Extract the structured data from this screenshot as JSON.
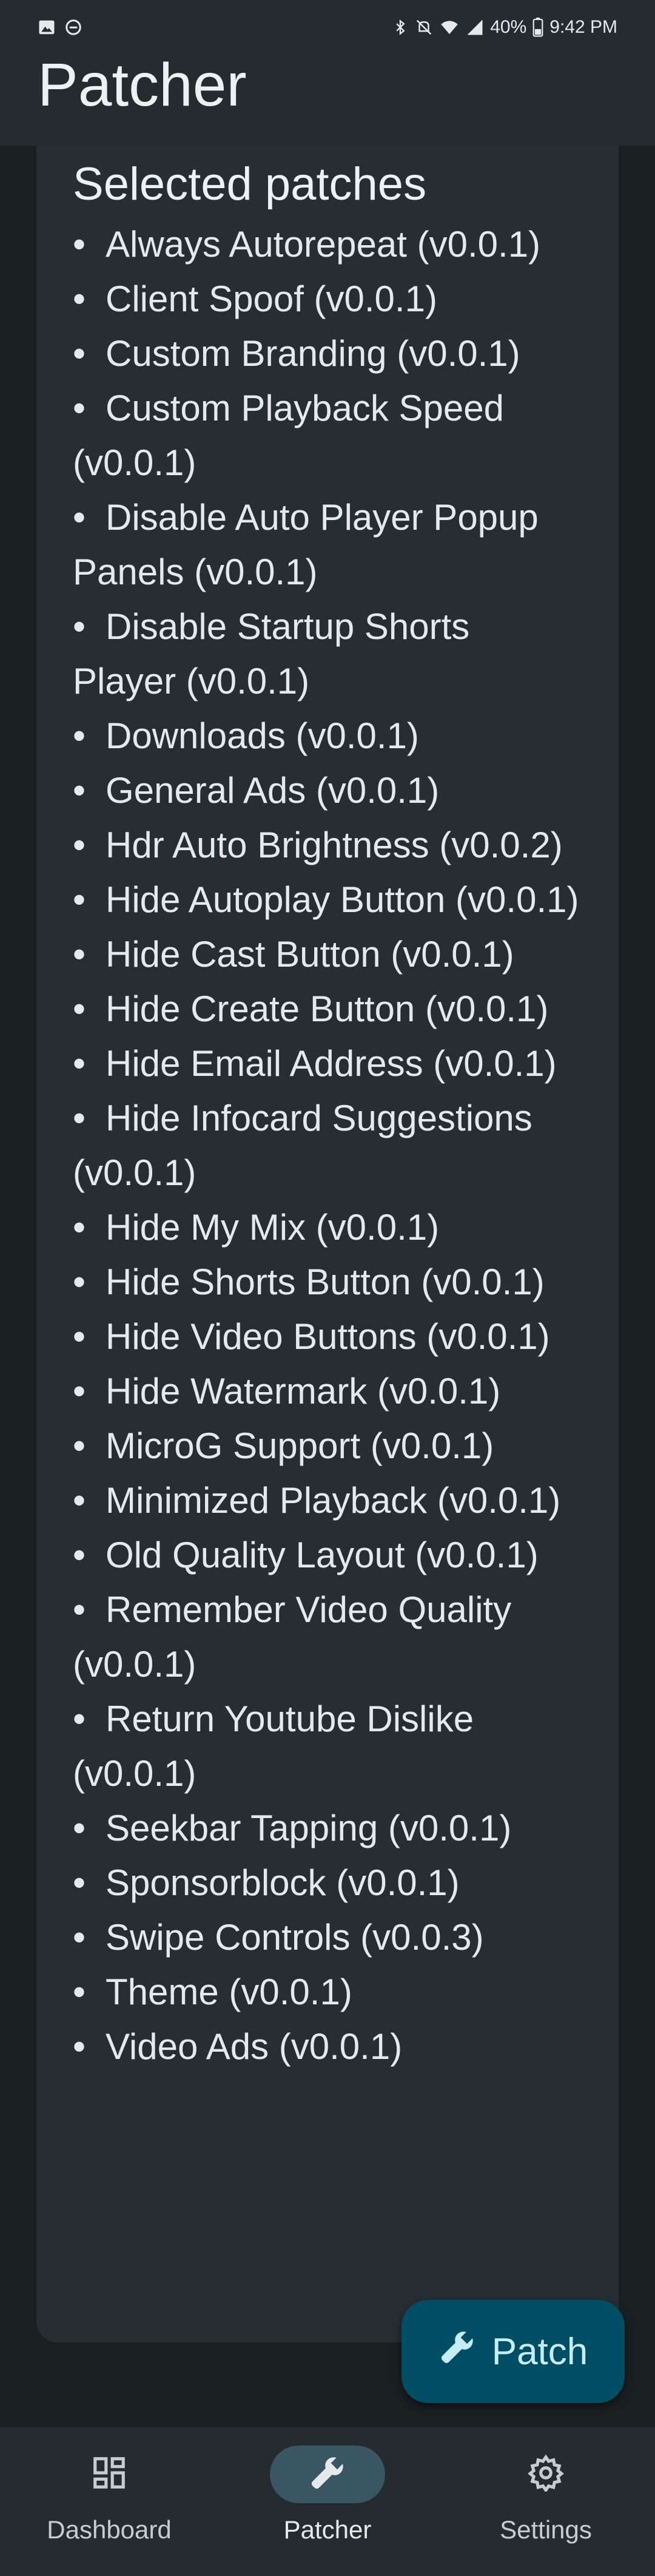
{
  "status_bar": {
    "battery": "40%",
    "time": "9:42 PM"
  },
  "app_bar": {
    "title": "Patcher"
  },
  "card": {
    "title": "Selected patches",
    "patches": [
      "Always Autorepeat (v0.0.1)",
      "Client Spoof (v0.0.1)",
      "Custom Branding (v0.0.1)",
      "Custom Playback Speed (v0.0.1)",
      "Disable Auto Player Popup Panels (v0.0.1)",
      "Disable Startup Shorts Player (v0.0.1)",
      "Downloads (v0.0.1)",
      "General Ads (v0.0.1)",
      "Hdr Auto Brightness (v0.0.2)",
      "Hide Autoplay Button (v0.0.1)",
      "Hide Cast Button (v0.0.1)",
      "Hide Create Button (v0.0.1)",
      "Hide Email Address (v0.0.1)",
      "Hide Infocard Suggestions (v0.0.1)",
      "Hide My Mix (v0.0.1)",
      "Hide Shorts Button (v0.0.1)",
      "Hide Video Buttons (v0.0.1)",
      "Hide Watermark (v0.0.1)",
      "MicroG Support (v0.0.1)",
      "Minimized Playback (v0.0.1)",
      "Old Quality Layout (v0.0.1)",
      "Remember Video Quality (v0.0.1)",
      "Return Youtube Dislike (v0.0.1)",
      "Seekbar Tapping (v0.0.1)",
      "Sponsorblock (v0.0.1)",
      "Swipe Controls (v0.0.3)",
      "Theme (v0.0.1)",
      "Video Ads (v0.0.1)"
    ]
  },
  "fab": {
    "label": "Patch",
    "icon": "wrench-icon"
  },
  "bottom_nav": {
    "items": [
      {
        "label": "Dashboard",
        "icon": "dashboard-icon",
        "active": false
      },
      {
        "label": "Patcher",
        "icon": "wrench-icon",
        "active": true
      },
      {
        "label": "Settings",
        "icon": "gear-icon",
        "active": false
      }
    ]
  },
  "colors": {
    "background": "#1a1f22",
    "surface": "#252c30",
    "card": "#262e33",
    "fab": "#004e63",
    "active_indicator": "#3a5662"
  }
}
